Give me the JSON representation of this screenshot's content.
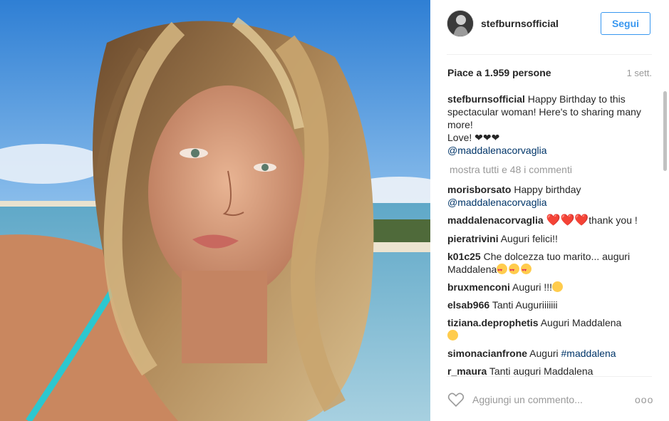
{
  "post": {
    "username": "stefburnsofficial",
    "follow_label": "Segui",
    "likes": "Piace a 1.959 persone",
    "time": "1 sett.",
    "caption": {
      "username": "stefburnsofficial",
      "text": "Happy Birthday to this spectacular woman! Here's to sharing many more!",
      "love_text": "Love!",
      "love_hearts": "❤❤❤",
      "mention": "@maddalenacorvaglia"
    },
    "show_all": "mostra tutti e 48 i commenti"
  },
  "comments": [
    {
      "user": "morisborsato",
      "text": "Happy birthday",
      "mention": "@maddalenacorvaglia"
    },
    {
      "user": "maddalenacorvaglia",
      "hearts": "❤️❤️❤️",
      "text": "thank you !"
    },
    {
      "user": "pieratrivini",
      "text": "Auguri felici!!"
    },
    {
      "user": "k01c25",
      "text": "Che dolcezza tuo marito... auguri Maddalena"
    },
    {
      "user": "bruxmenconi",
      "text": "Auguri !!!"
    },
    {
      "user": "elsab966",
      "text": "Tanti Auguriiiiiii"
    },
    {
      "user": "tiziana.deprophetis",
      "text": "Auguri Maddalena"
    },
    {
      "user": "simonacianfrone",
      "text": "Auguri",
      "tag": "#maddalena"
    },
    {
      "user": "r_maura",
      "text": "Tanti auguri Maddalena"
    }
  ],
  "footer": {
    "add_comment_placeholder": "Aggiungi un commento...",
    "more_options": "ooo"
  },
  "icons": {
    "like": "heart-outline-icon",
    "options": "more-options-icon"
  },
  "colors": {
    "accent": "#3897f0",
    "link": "#003569",
    "muted": "#999999"
  }
}
